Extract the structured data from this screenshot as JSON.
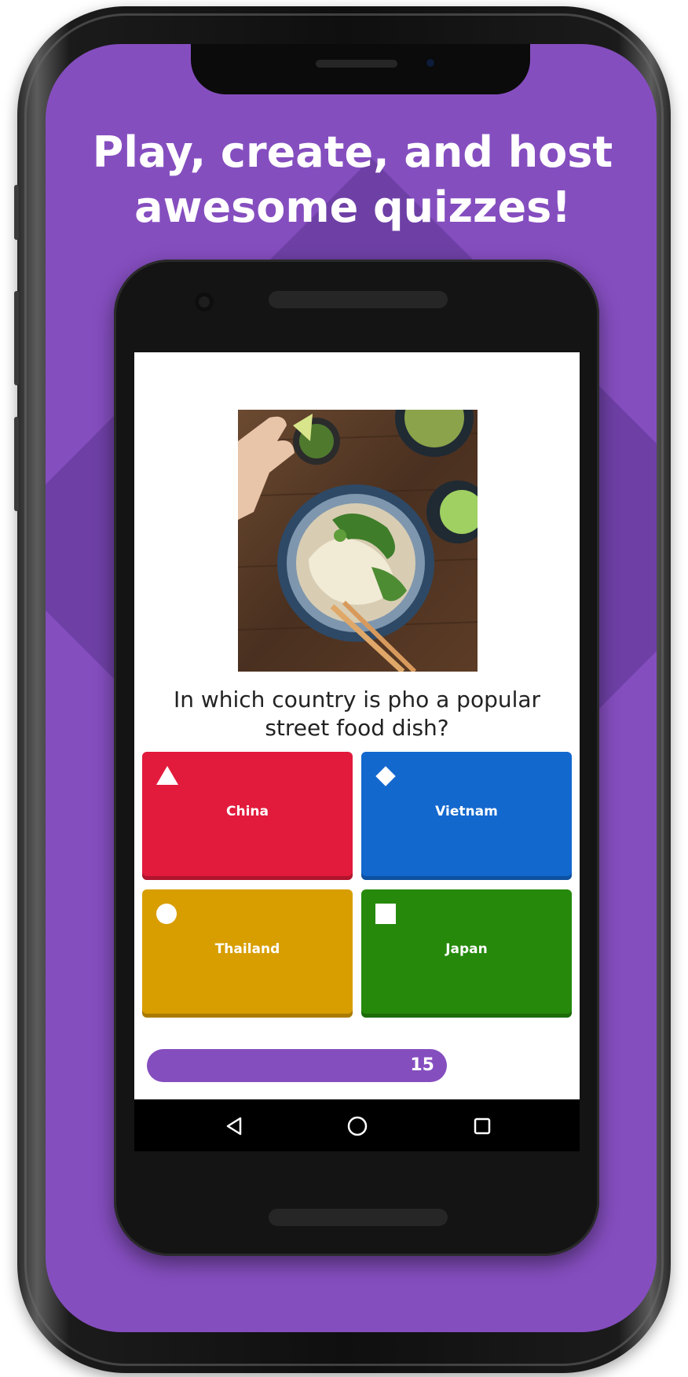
{
  "promo": {
    "headline_line1": "Play, create, and host",
    "headline_line2": "awesome quizzes!",
    "background_color": "#854ebf"
  },
  "quiz": {
    "question_line1": "In which country is pho a popular",
    "question_line2": "street food dish?",
    "answers": [
      {
        "label": "China",
        "shape": "triangle-icon",
        "color": "#e21b3c"
      },
      {
        "label": "Vietnam",
        "shape": "diamond-icon",
        "color": "#1368ce"
      },
      {
        "label": "Thailand",
        "shape": "circle-icon",
        "color": "#d89e00"
      },
      {
        "label": "Japan",
        "shape": "square-icon",
        "color": "#26890c"
      }
    ],
    "timer": {
      "value": "15",
      "fraction": 0.69
    }
  },
  "nav": {
    "back": "back-triangle-icon",
    "home": "home-circle-icon",
    "recents": "recents-square-icon"
  }
}
